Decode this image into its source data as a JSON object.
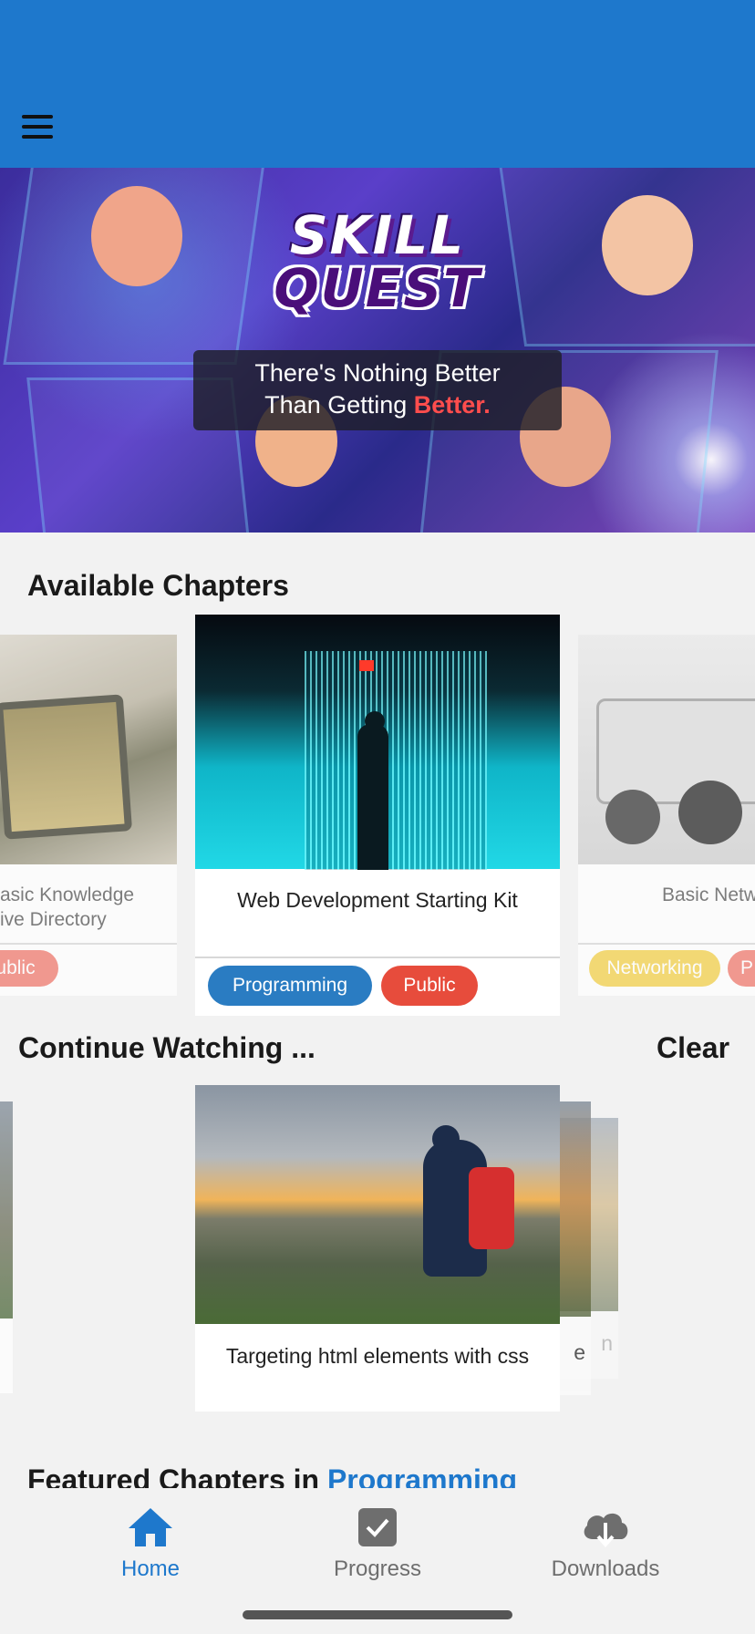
{
  "colors": {
    "brand_blue": "#1e78cc",
    "programming_tag": "#2a7cc2",
    "public_tag": "#e74c3c",
    "networking_tag": "#f2d04a",
    "nav_active": "#1e78cc",
    "nav_inactive": "#6e6e6e"
  },
  "header": {
    "menu_icon": "hamburger-menu-icon"
  },
  "hero": {
    "logo_line1": "SKILL",
    "logo_line2": "QUEST",
    "tagline_line1": "There's Nothing Better",
    "tagline_line2_prefix": "Than Getting ",
    "tagline_accent": "Better."
  },
  "available_chapters": {
    "title": "Available Chapters",
    "cards": [
      {
        "caption_line1": "asic Knowledge",
        "caption_line2": "ive Directory",
        "tags": [
          "ublic"
        ]
      },
      {
        "caption_line1": "Web Development Starting Kit",
        "caption_line2": "",
        "tags": [
          "Programming",
          "Public"
        ]
      },
      {
        "caption_line1": "Basic Netw",
        "caption_line2": "",
        "tags": [
          "Networking",
          "P"
        ]
      }
    ]
  },
  "continue_watching": {
    "title": "Continue Watching ...",
    "clear_label": "Clear",
    "cards": [
      {
        "caption": "Targeting html elements with css"
      },
      {
        "caption": "e"
      },
      {
        "caption": "n"
      }
    ]
  },
  "featured": {
    "title_prefix": "Featured Chapters in ",
    "title_accent": "Programming"
  },
  "bottom_nav": {
    "items": [
      {
        "label": "Home",
        "icon": "home-icon",
        "active": true
      },
      {
        "label": "Progress",
        "icon": "checkbox-icon",
        "active": false
      },
      {
        "label": "Downloads",
        "icon": "cloud-download-icon",
        "active": false
      }
    ]
  }
}
